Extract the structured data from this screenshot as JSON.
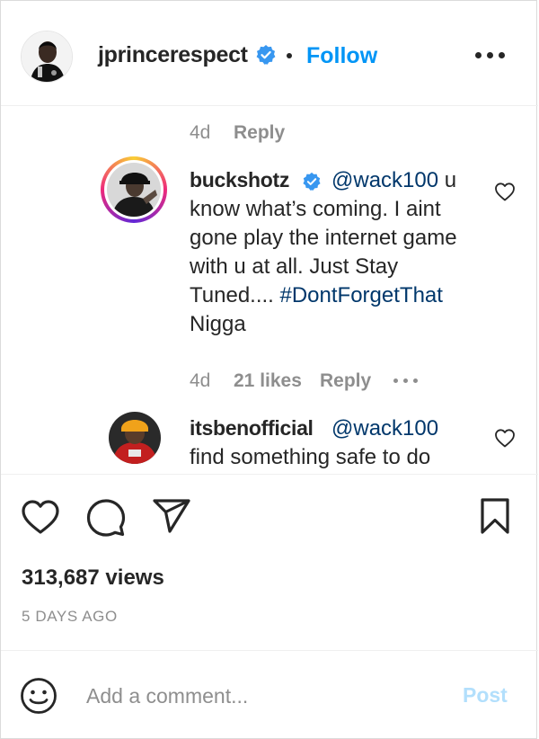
{
  "header": {
    "username": "jprincerespect",
    "follow_label": "Follow"
  },
  "comments": {
    "prev_reply": {
      "age": "4d",
      "reply_label": "Reply"
    },
    "items": [
      {
        "username": "buckshotz",
        "mention": "@wack100",
        "text_main": " u know what’s coming. I aint gone play the internet game with u at all. Just Stay Tuned.... ",
        "hashtag": "#DontForgetThat",
        "text_tail": " Nigga",
        "age": "4d",
        "likes": "21 likes",
        "reply_label": "Reply"
      },
      {
        "username": "itsbenofficial",
        "mention": "@wack100",
        "text_main": " find something safe to do"
      }
    ]
  },
  "post": {
    "views": "313,687 views",
    "posted_ago": "5 DAYS AGO"
  },
  "comment_box": {
    "placeholder": "Add a comment...",
    "post_label": "Post"
  },
  "colors": {
    "link_blue": "#0095f6",
    "mention_blue": "#00376b",
    "muted_gray": "#8e8e8e",
    "post_disabled": "#b2dffc",
    "verified_blue": "#3897f0"
  },
  "icons": {
    "header_more": "more-horizontal-icon",
    "verified": "verified-badge-icon",
    "like": "heart-icon",
    "comment": "comment-bubble-icon",
    "share": "paper-plane-icon",
    "save": "bookmark-icon",
    "emoji": "smiley-face-icon"
  }
}
